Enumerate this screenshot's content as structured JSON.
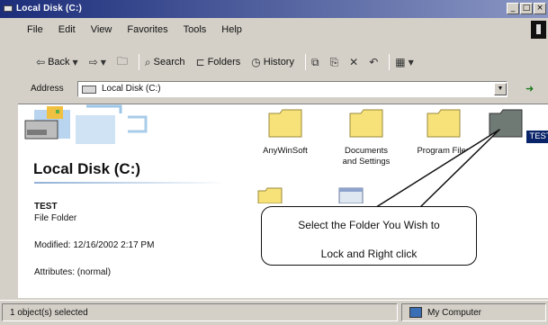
{
  "window": {
    "title": "Local Disk (C:)"
  },
  "menu": {
    "items": [
      "File",
      "Edit",
      "View",
      "Favorites",
      "Tools",
      "Help"
    ]
  },
  "toolbar": {
    "back": "Back",
    "search": "Search",
    "folders": "Folders",
    "history": "History"
  },
  "address": {
    "label": "Address",
    "value": "Local Disk (C:)"
  },
  "left_pane": {
    "title": "Local Disk (C:)",
    "selected_name": "TEST",
    "selected_type": "File Folder",
    "modified": "Modified: 12/16/2002 2:17 PM",
    "attributes": "Attributes: (normal)"
  },
  "files": [
    {
      "label": "AnyWinSoft",
      "icon": "folder-icon"
    },
    {
      "label": "Documents and Settings",
      "icon": "folder-icon"
    },
    {
      "label": "Program Files",
      "icon": "folder-icon"
    },
    {
      "label": "TEST",
      "icon": "folder-icon",
      "selected": true
    }
  ],
  "callout": {
    "line1": "Select the Folder You Wish to",
    "line2": "Lock and Right click"
  },
  "status": {
    "left": "1 object(s) selected",
    "right": "My Computer"
  },
  "colors": {
    "title_bar_start": "#1c2d7a",
    "selection": "#0a246a",
    "folder": "#f7e27a",
    "folder_selected": "#6f7a74"
  }
}
